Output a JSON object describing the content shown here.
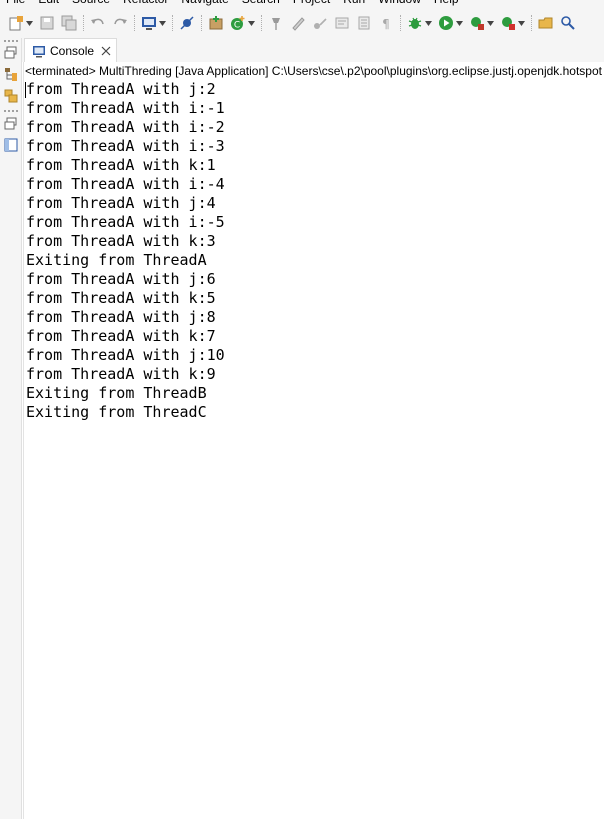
{
  "menu": [
    "File",
    "Edit",
    "Source",
    "Refactor",
    "Navigate",
    "Search",
    "Project",
    "Run",
    "Window",
    "Help"
  ],
  "toolbar": {
    "icons": [
      "new-icon",
      "save-icon",
      "save-all-icon",
      "undo-icon",
      "redo-icon",
      "terminal-icon",
      "skip-breakpoints-icon",
      "new-java-package-icon",
      "new-class-icon",
      "pin-icon",
      "pen-icon",
      "next-annotation-icon",
      "previous-annotation-icon",
      "toggle-block-icon",
      "show-whitespace-icon",
      "debug-icon",
      "run-icon",
      "coverage-icon",
      "external-tools-icon",
      "open-type-icon",
      "search-icon"
    ],
    "colors": {
      "green": "#2e9c3f",
      "blue": "#2d5aa6",
      "orange": "#e8a33a",
      "gray": "#9a9a9a"
    }
  },
  "leftbar": {
    "icons": [
      "restore-icon",
      "hierarchy-icon",
      "package-explorer-icon",
      "restore-icon",
      "outline-icon"
    ]
  },
  "tab": {
    "label": "Console",
    "icon": "console-icon",
    "close": "close-icon"
  },
  "console": {
    "status": "<terminated> MultiThreding [Java Application] C:\\Users\\cse\\.p2\\pool\\plugins\\org.eclipse.justj.openjdk.hotspot",
    "lines": [
      "from ThreadA with j:2",
      "from ThreadA with i:-1",
      "from ThreadA with i:-2",
      "from ThreadA with i:-3",
      "from ThreadA with k:1",
      "from ThreadA with i:-4",
      "from ThreadA with j:4",
      "from ThreadA with i:-5",
      "from ThreadA with k:3",
      "Exiting from ThreadA",
      "from ThreadA with j:6",
      "from ThreadA with k:5",
      "from ThreadA with j:8",
      "from ThreadA with k:7",
      "from ThreadA with j:10",
      "from ThreadA with k:9",
      "Exiting from ThreadB",
      "Exiting from ThreadC"
    ]
  }
}
